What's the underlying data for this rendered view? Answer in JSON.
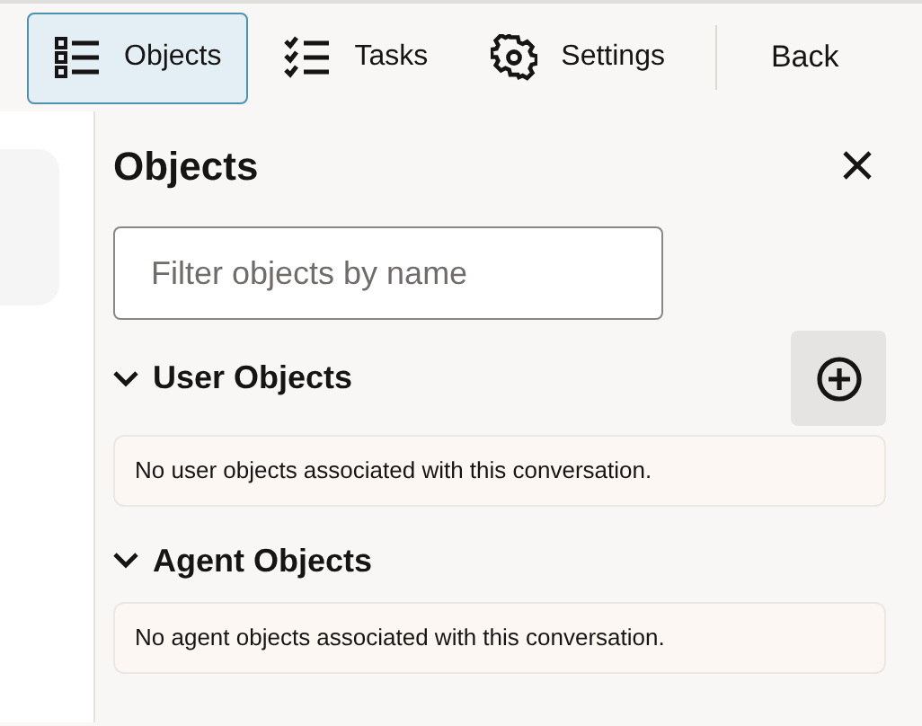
{
  "toolbar": {
    "tabs": [
      {
        "label": "Objects",
        "kind": "list",
        "selected": true
      },
      {
        "label": "Tasks",
        "kind": "checklist",
        "selected": false
      },
      {
        "label": "Settings",
        "kind": "gear",
        "selected": false
      }
    ],
    "back": "Back"
  },
  "panel": {
    "title": "Objects",
    "filter": {
      "placeholder": "Filter objects by name"
    },
    "sections": [
      {
        "title": "User Objects",
        "expanded": true,
        "add_button": true,
        "message": "No user objects associated with this conversation."
      },
      {
        "title": "Agent Objects",
        "expanded": true,
        "add_button": false,
        "message": "No agent objects associated with this conversation."
      }
    ]
  }
}
